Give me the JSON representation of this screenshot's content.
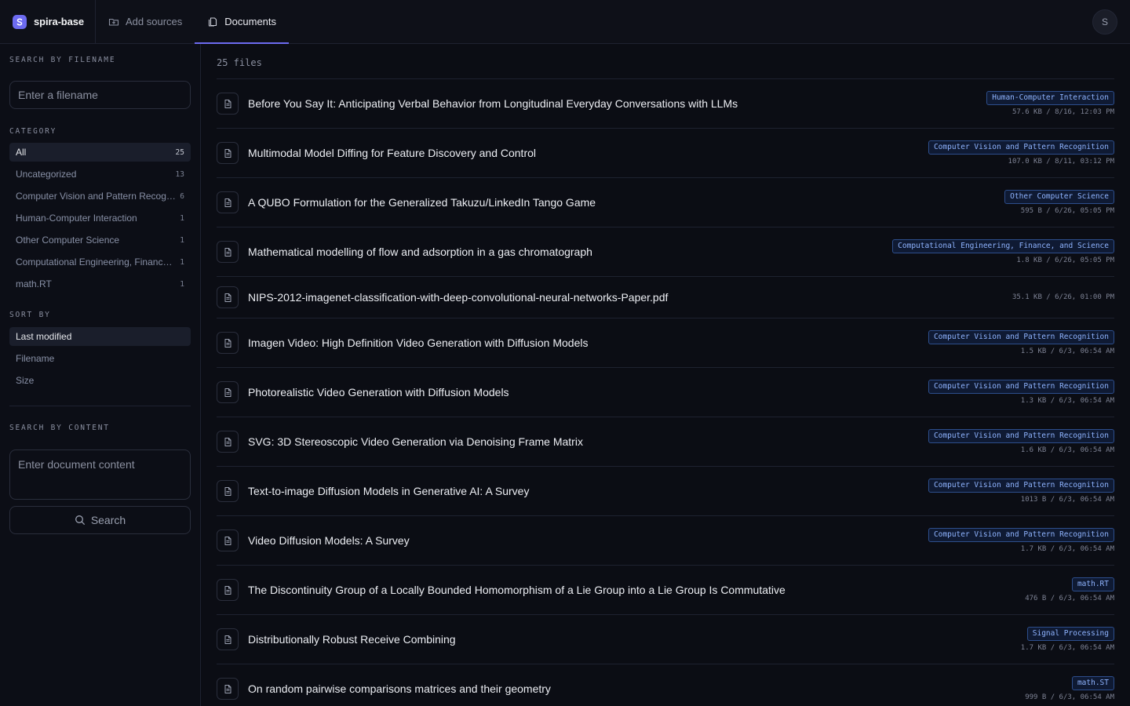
{
  "app": {
    "name": "spira-base",
    "avatar_initial": "S"
  },
  "tabs": [
    {
      "label": "Add sources",
      "icon": "folder-plus-icon"
    },
    {
      "label": "Documents",
      "icon": "documents-icon"
    }
  ],
  "sidebar": {
    "search_filename_label": "SEARCH BY FILENAME",
    "filename_placeholder": "Enter a filename",
    "category_label": "CATEGORY",
    "categories": [
      {
        "label": "All",
        "count": "25"
      },
      {
        "label": "Uncategorized",
        "count": "13"
      },
      {
        "label": "Computer Vision and Pattern Recognition",
        "count": "6"
      },
      {
        "label": "Human-Computer Interaction",
        "count": "1"
      },
      {
        "label": "Other Computer Science",
        "count": "1"
      },
      {
        "label": "Computational Engineering, Finance, and Science",
        "count": "1"
      },
      {
        "label": "math.RT",
        "count": "1"
      }
    ],
    "sort_label": "SORT BY",
    "sort_options": [
      "Last modified",
      "Filename",
      "Size"
    ],
    "search_content_label": "SEARCH BY CONTENT",
    "content_placeholder": "Enter document content",
    "search_button": "Search"
  },
  "main": {
    "file_count": "25 files",
    "files": [
      {
        "title": "Before You Say It: Anticipating Verbal Behavior from Longitudinal Everyday Conversations with LLMs",
        "category": "Human-Computer Interaction",
        "info": "57.6 KB / 8/16, 12:03 PM"
      },
      {
        "title": "Multimodal Model Diffing for Feature Discovery and Control",
        "category": "Computer Vision and Pattern Recognition",
        "info": "107.0 KB / 8/11, 03:12 PM"
      },
      {
        "title": "A QUBO Formulation for the Generalized Takuzu/LinkedIn Tango Game",
        "category": "Other Computer Science",
        "info": "595 B / 6/26, 05:05 PM"
      },
      {
        "title": "Mathematical modelling of flow and adsorption in a gas chromatograph",
        "category": "Computational Engineering, Finance, and Science",
        "info": "1.8 KB / 6/26, 05:05 PM"
      },
      {
        "title": "NIPS-2012-imagenet-classification-with-deep-convolutional-neural-networks-Paper.pdf",
        "category": "",
        "info": "35.1 KB / 6/26, 01:00 PM"
      },
      {
        "title": "Imagen Video: High Definition Video Generation with Diffusion Models",
        "category": "Computer Vision and Pattern Recognition",
        "info": "1.5 KB / 6/3, 06:54 AM"
      },
      {
        "title": "Photorealistic Video Generation with Diffusion Models",
        "category": "Computer Vision and Pattern Recognition",
        "info": "1.3 KB / 6/3, 06:54 AM"
      },
      {
        "title": "SVG: 3D Stereoscopic Video Generation via Denoising Frame Matrix",
        "category": "Computer Vision and Pattern Recognition",
        "info": "1.6 KB / 6/3, 06:54 AM"
      },
      {
        "title": "Text-to-image Diffusion Models in Generative AI: A Survey",
        "category": "Computer Vision and Pattern Recognition",
        "info": "1013 B / 6/3, 06:54 AM"
      },
      {
        "title": "Video Diffusion Models: A Survey",
        "category": "Computer Vision and Pattern Recognition",
        "info": "1.7 KB / 6/3, 06:54 AM"
      },
      {
        "title": "The Discontinuity Group of a Locally Bounded Homomorphism of a Lie Group into a Lie Group Is Commutative",
        "category": "math.RT",
        "info": "476 B / 6/3, 06:54 AM"
      },
      {
        "title": "Distributionally Robust Receive Combining",
        "category": "Signal Processing",
        "info": "1.7 KB / 6/3, 06:54 AM"
      },
      {
        "title": "On random pairwise comparisons matrices and their geometry",
        "category": "math.ST",
        "info": "999 B / 6/3, 06:54 AM"
      }
    ]
  },
  "colors": {
    "accent": "#6d6bf0",
    "badge_text": "#8fb4ff",
    "background": "#0b0d14"
  }
}
